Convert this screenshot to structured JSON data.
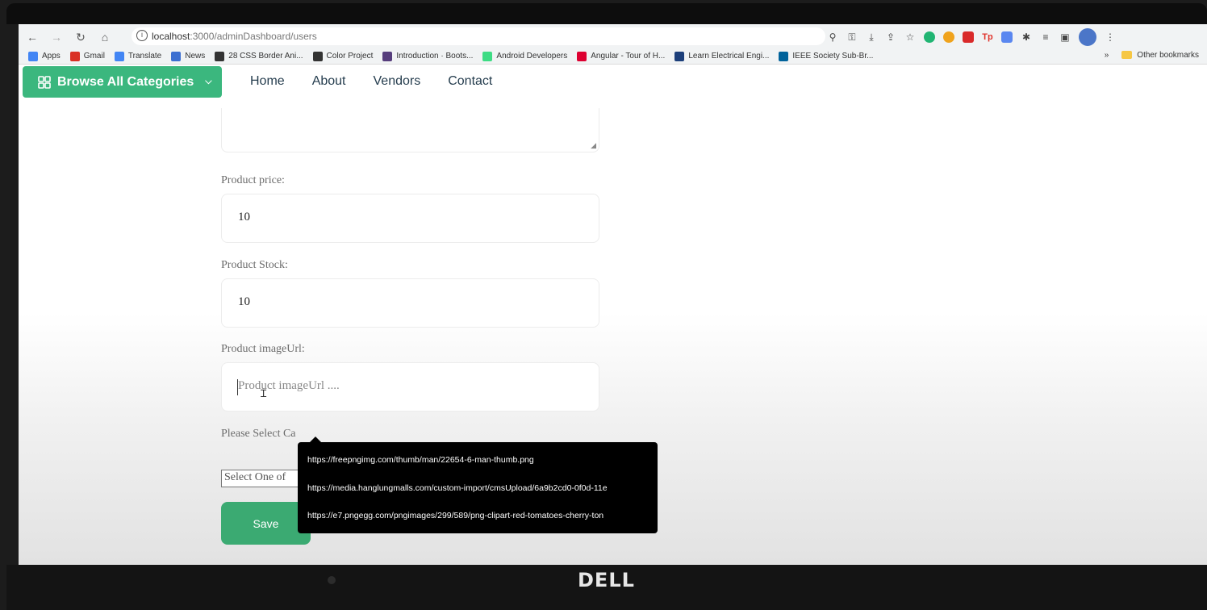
{
  "browser": {
    "url_host": "localhost",
    "url_rest": ":3000/adminDashboard/users",
    "bookmarks": [
      {
        "label": "Apps",
        "color": "#4285f4"
      },
      {
        "label": "Gmail",
        "color": "#d93025"
      },
      {
        "label": "Translate",
        "color": "#4285f4"
      },
      {
        "label": "News",
        "color": "#3c6fd1"
      },
      {
        "label": "28 CSS Border Ani...",
        "color": "#333333"
      },
      {
        "label": "Color Project",
        "color": "#333333"
      },
      {
        "label": "Introduction · Boots...",
        "color": "#563d7c"
      },
      {
        "label": "Android Developers",
        "color": "#3ddc84"
      },
      {
        "label": "Angular - Tour of H...",
        "color": "#dd0031"
      },
      {
        "label": "Learn Electrical Engi...",
        "color": "#1c3f7a"
      },
      {
        "label": "IEEE Society Sub-Br...",
        "color": "#00629b"
      }
    ],
    "more_bookmarks": "»",
    "other_bookmarks": "Other bookmarks"
  },
  "header": {
    "browse_label": "Browse All Categories",
    "nav": [
      "Home",
      "About",
      "Vendors",
      "Contact"
    ]
  },
  "form": {
    "price_label": "Product price:",
    "price_value": "10",
    "stock_label": "Product Stock:",
    "stock_value": "10",
    "image_label": "Product imageUrl:",
    "image_placeholder": "Product imageUrl ....",
    "category_label": "Please Select Ca",
    "category_select": "Select One of",
    "save_label": "Save"
  },
  "autocomplete": [
    "https://freepngimg.com/thumb/man/22654-6-man-thumb.png",
    "https://media.hanglungmalls.com/custom-import/cmsUpload/6a9b2cd0-0f0d-11e",
    "https://e7.pngegg.com/pngimages/299/589/png-clipart-red-tomatoes-cherry-ton"
  ],
  "device": {
    "brand": "DELL"
  },
  "colors": {
    "accent": "#3bb77e",
    "save": "#3baa72",
    "heading": "#253d4e"
  }
}
